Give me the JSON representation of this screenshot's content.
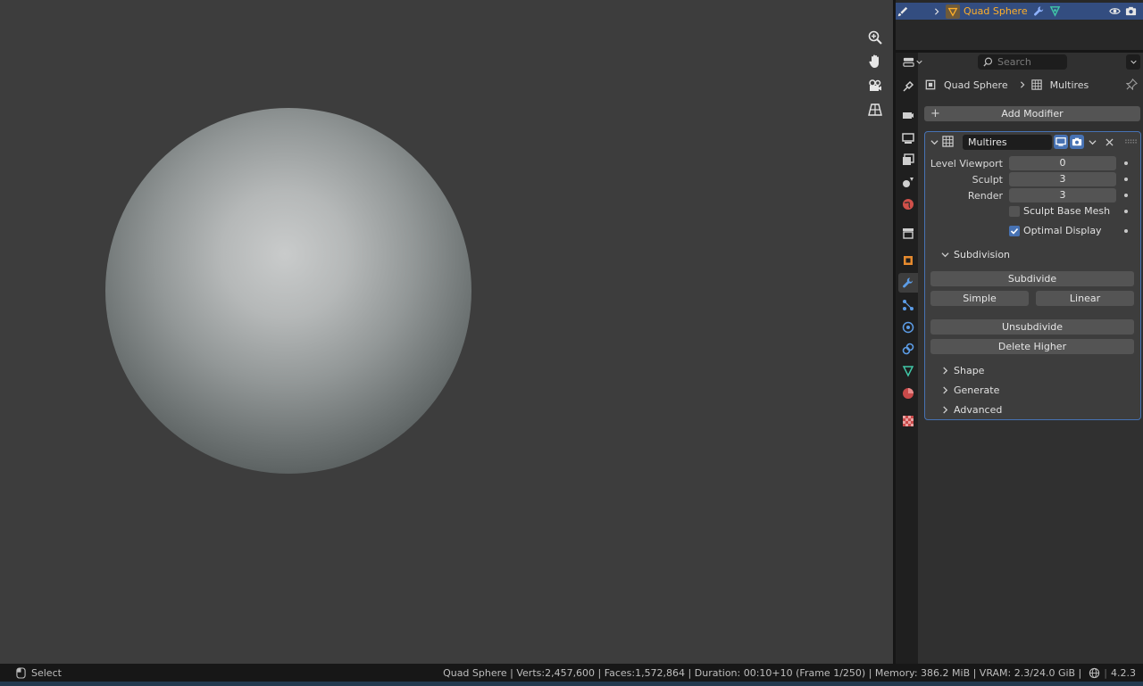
{
  "outliner": {
    "object_name": "Quad Sphere"
  },
  "properties": {
    "search_placeholder": "Search",
    "breadcrumb": {
      "object": "Quad Sphere",
      "modifier": "Multires"
    },
    "add_modifier_label": "Add Modifier",
    "modifier": {
      "name": "Multires",
      "level_viewport_label": "Level Viewport",
      "level_viewport_value": "0",
      "sculpt_label": "Sculpt",
      "sculpt_value": "3",
      "render_label": "Render",
      "render_value": "3",
      "sculpt_base_mesh_label": "Sculpt Base Mesh",
      "sculpt_base_mesh_checked": false,
      "optimal_display_label": "Optimal Display",
      "optimal_display_checked": true,
      "subdivision_label": "Subdivision",
      "subdivide_label": "Subdivide",
      "simple_label": "Simple",
      "linear_label": "Linear",
      "unsubdivide_label": "Unsubdivide",
      "delete_higher_label": "Delete Higher",
      "shape_label": "Shape",
      "generate_label": "Generate",
      "advanced_label": "Advanced"
    }
  },
  "status_bar": {
    "left_action": "Select",
    "stats": "Quad Sphere | Verts:2,457,600 | Faces:1,572,864 | Duration: 00:10+10 (Frame 1/250) | Memory: 386.2 MiB | VRAM: 2.3/24.0 GiB |",
    "version": "4.2.3"
  },
  "colors": {
    "accent": "#4772b3",
    "selection_row": "#334d80",
    "object_name": "#ffaf29",
    "viewport_bg": "#3d3d3d"
  }
}
